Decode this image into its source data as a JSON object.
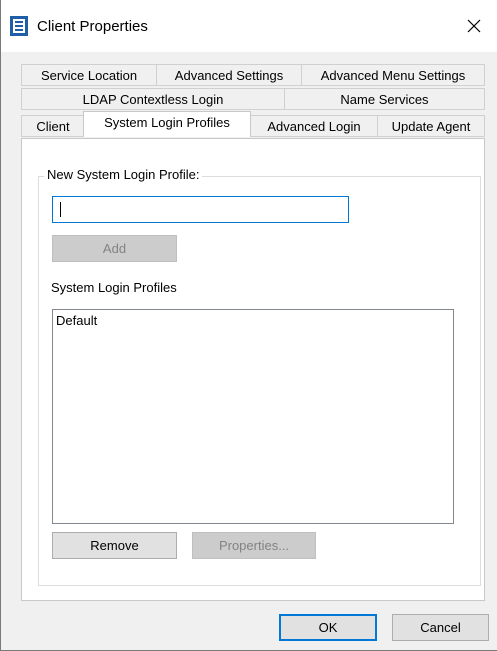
{
  "window": {
    "title": "Client Properties",
    "close_glyph": "✕"
  },
  "tabs": {
    "row1": [
      "Service Location",
      "Advanced Settings",
      "Advanced Menu Settings"
    ],
    "row2": [
      "LDAP Contextless Login",
      "Name Services"
    ],
    "row3": [
      "Client",
      "System Login Profiles",
      "Advanced Login",
      "Update Agent"
    ],
    "active": "System Login Profiles"
  },
  "group": {
    "legend": "New System Login Profile:",
    "input_value": "",
    "add_label": "Add"
  },
  "profiles": {
    "label": "System Login Profiles",
    "items": [
      "Default"
    ],
    "remove_label": "Remove",
    "properties_label": "Properties..."
  },
  "footer": {
    "ok_label": "OK",
    "cancel_label": "Cancel"
  },
  "colors": {
    "focus_blue": "#0078d7",
    "app_icon": "#1f5fa8"
  },
  "icons": {
    "app": "novell-client-icon",
    "close": "close-icon"
  }
}
